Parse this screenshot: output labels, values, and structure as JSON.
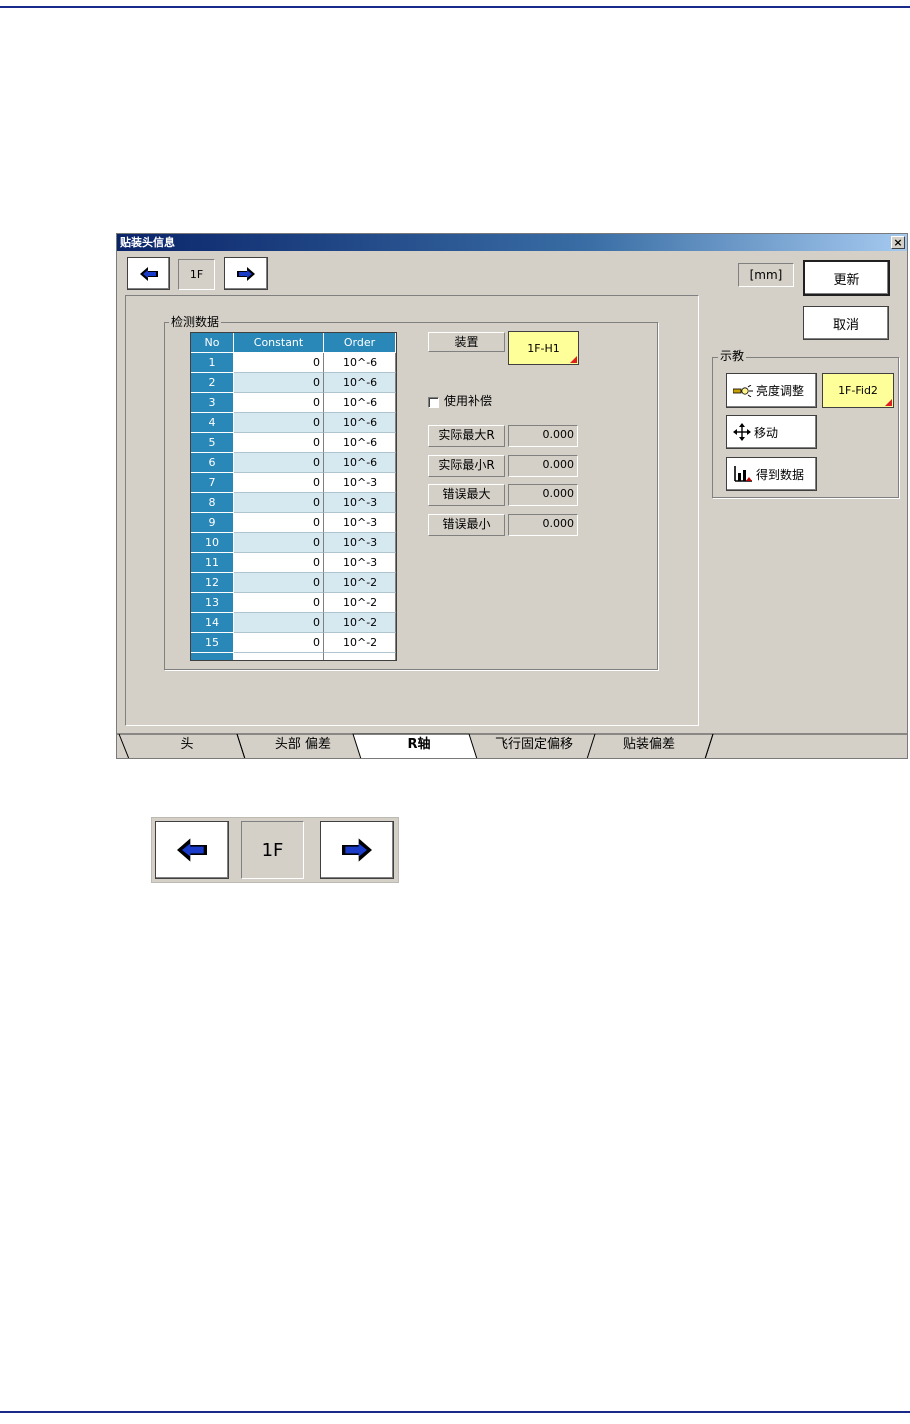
{
  "dialog": {
    "title": "贴装头信息",
    "close_label": "×",
    "nav": {
      "current": "1F"
    },
    "unit_label": "[mm]",
    "update_label": "更新",
    "cancel_label": "取消",
    "detection_group": {
      "title": "检测数据",
      "columns": [
        "No",
        "Constant",
        "Order"
      ],
      "rows": [
        {
          "no": "1",
          "constant": "0",
          "order": "10^-6"
        },
        {
          "no": "2",
          "constant": "0",
          "order": "10^-6"
        },
        {
          "no": "3",
          "constant": "0",
          "order": "10^-6"
        },
        {
          "no": "4",
          "constant": "0",
          "order": "10^-6"
        },
        {
          "no": "5",
          "constant": "0",
          "order": "10^-6"
        },
        {
          "no": "6",
          "constant": "0",
          "order": "10^-6"
        },
        {
          "no": "7",
          "constant": "0",
          "order": "10^-3"
        },
        {
          "no": "8",
          "constant": "0",
          "order": "10^-3"
        },
        {
          "no": "9",
          "constant": "0",
          "order": "10^-3"
        },
        {
          "no": "10",
          "constant": "0",
          "order": "10^-3"
        },
        {
          "no": "11",
          "constant": "0",
          "order": "10^-3"
        },
        {
          "no": "12",
          "constant": "0",
          "order": "10^-2"
        },
        {
          "no": "13",
          "constant": "0",
          "order": "10^-2"
        },
        {
          "no": "14",
          "constant": "0",
          "order": "10^-2"
        },
        {
          "no": "15",
          "constant": "0",
          "order": "10^-2"
        }
      ],
      "device_label": "装置",
      "device_value": "1F-H1",
      "use_compensation_label": "使用补偿",
      "fields": [
        {
          "label": "实际最大R",
          "value": "0.000"
        },
        {
          "label": "实际最小R",
          "value": "0.000"
        },
        {
          "label": "错误最大",
          "value": "0.000"
        },
        {
          "label": "错误最小",
          "value": "0.000"
        }
      ]
    },
    "teach_group": {
      "title": "示教",
      "brightness_label": "亮度调整",
      "fid_value": "1F-Fid2",
      "move_label": "移动",
      "get_data_label": "得到数据"
    },
    "tabs": [
      "头",
      "头部 偏差",
      "R轴",
      "飞行固定偏移",
      "贴装偏差"
    ],
    "active_tab": "R轴"
  },
  "inset": {
    "current": "1F"
  },
  "colors": {
    "grid_header": "#2a88b8",
    "grid_alt_row": "#d6e8f0",
    "highlight_yellow": "#ffff99",
    "dialog_face": "#d4d0c8",
    "arrow_blue": "#1a3cc8"
  }
}
